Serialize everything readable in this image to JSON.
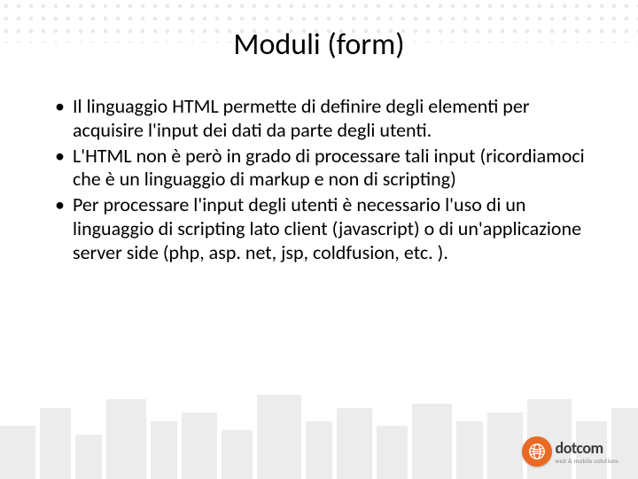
{
  "slide": {
    "title": "Moduli (form)",
    "bullets": [
      "Il linguaggio HTML permette di definire degli elementi per acquisire l'input dei dati da parte degli utenti.",
      "L'HTML non è però in grado di processare tali input (ricordiamoci che è un linguaggio di markup e non di scripting)",
      "Per processare l'input degli utenti è necessario l'uso di un linguaggio di scripting lato client (javascript) o di un'applicazione server side (php, asp. net, jsp, coldfusion, etc. )."
    ]
  },
  "logo": {
    "brand": "dotcom",
    "tagline": "web & mobile solutions"
  }
}
